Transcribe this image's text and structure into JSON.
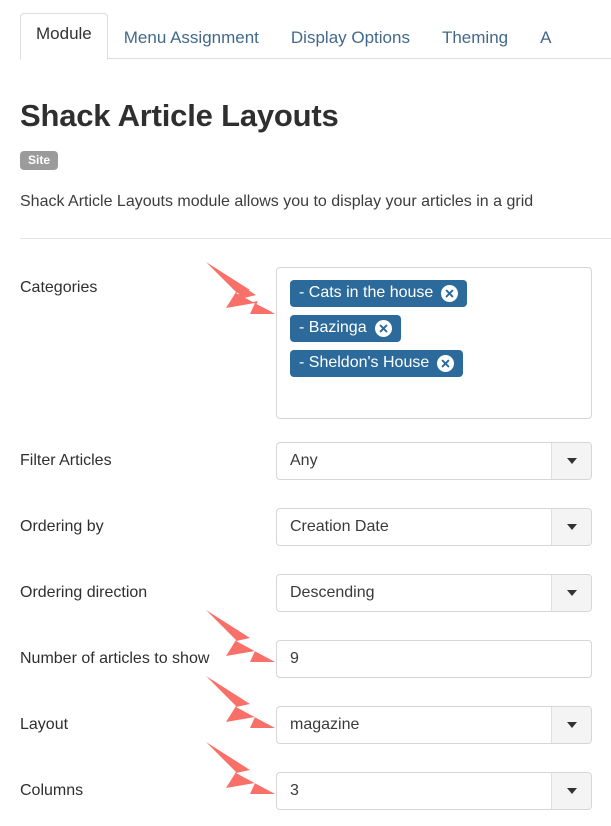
{
  "tabs": [
    {
      "label": "Module",
      "active": true
    },
    {
      "label": "Menu Assignment",
      "active": false
    },
    {
      "label": "Display Options",
      "active": false
    },
    {
      "label": "Theming",
      "active": false
    },
    {
      "label": "A",
      "active": false
    }
  ],
  "header": {
    "title": "Shack Article Layouts",
    "badge": "Site",
    "description": "Shack Article Layouts module allows you to display your articles in a grid"
  },
  "form": {
    "categories": {
      "label": "Categories",
      "tags": [
        {
          "text": "- Cats in the house",
          "remove": "remove-icon"
        },
        {
          "text": "- Bazinga",
          "remove": "remove-icon"
        },
        {
          "text": "- Sheldon's House",
          "remove": "remove-icon"
        }
      ]
    },
    "filter_articles": {
      "label": "Filter Articles",
      "value": "Any"
    },
    "ordering_by": {
      "label": "Ordering by",
      "value": "Creation Date"
    },
    "ordering_direction": {
      "label": "Ordering direction",
      "value": "Descending"
    },
    "number_of_articles": {
      "label": "Number of articles to show",
      "value": "9"
    },
    "layout": {
      "label": "Layout",
      "value": "magazine"
    },
    "columns": {
      "label": "Columns",
      "value": "3"
    }
  },
  "colors": {
    "tag_blue": "#2b6a9b",
    "tab_link": "#42698b",
    "badge_gray": "#9b9b9b",
    "annotation_arrow": "#f97068"
  }
}
